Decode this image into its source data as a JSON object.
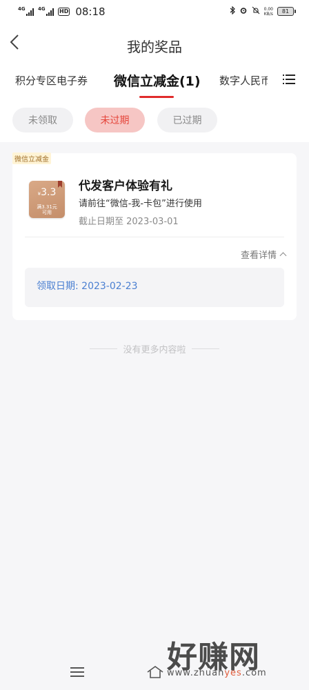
{
  "status_bar": {
    "sim1": "4G",
    "sim2": "4G",
    "hd_badge": "HD",
    "time": "08:18",
    "net_speed_value": "0.00",
    "net_speed_unit": "KB/s",
    "battery": "81",
    "icons": [
      "bluetooth-icon",
      "alarm-icon",
      "mute-icon"
    ]
  },
  "nav": {
    "title": "我的奖品",
    "back_icon": "chevron-left-icon"
  },
  "tabs": [
    {
      "label": "积分专区电子券",
      "active": false
    },
    {
      "label": "微信立减金(1)",
      "active": true
    },
    {
      "label": "数字人民币",
      "active": false
    }
  ],
  "filters": [
    {
      "label": "未领取",
      "active": false
    },
    {
      "label": "未过期",
      "active": true
    },
    {
      "label": "已过期",
      "active": false
    }
  ],
  "card": {
    "tag": "微信立减金",
    "coupon_currency": "¥",
    "coupon_amount": "3.3",
    "coupon_condition_line1": "满3.31元",
    "coupon_condition_line2": "可用",
    "title": "代发客户体验有礼",
    "description": "请前往“微信-我-卡包”进行使用",
    "expiry": "截止日期至 2023-03-01",
    "details_label": "查看详情",
    "claim_date": "领取日期: 2023-02-23"
  },
  "footer_text": "没有更多内容啦",
  "watermark": {
    "big": "好赚网",
    "url_prefix": "www.zhuan",
    "url_accent": "yes",
    "url_suffix": ".com"
  },
  "colors": {
    "accent_red": "#e02b2b",
    "active_chip_bg": "#f6c6c4",
    "active_chip_text": "#e5453b",
    "link_blue": "#4a7fd1"
  }
}
